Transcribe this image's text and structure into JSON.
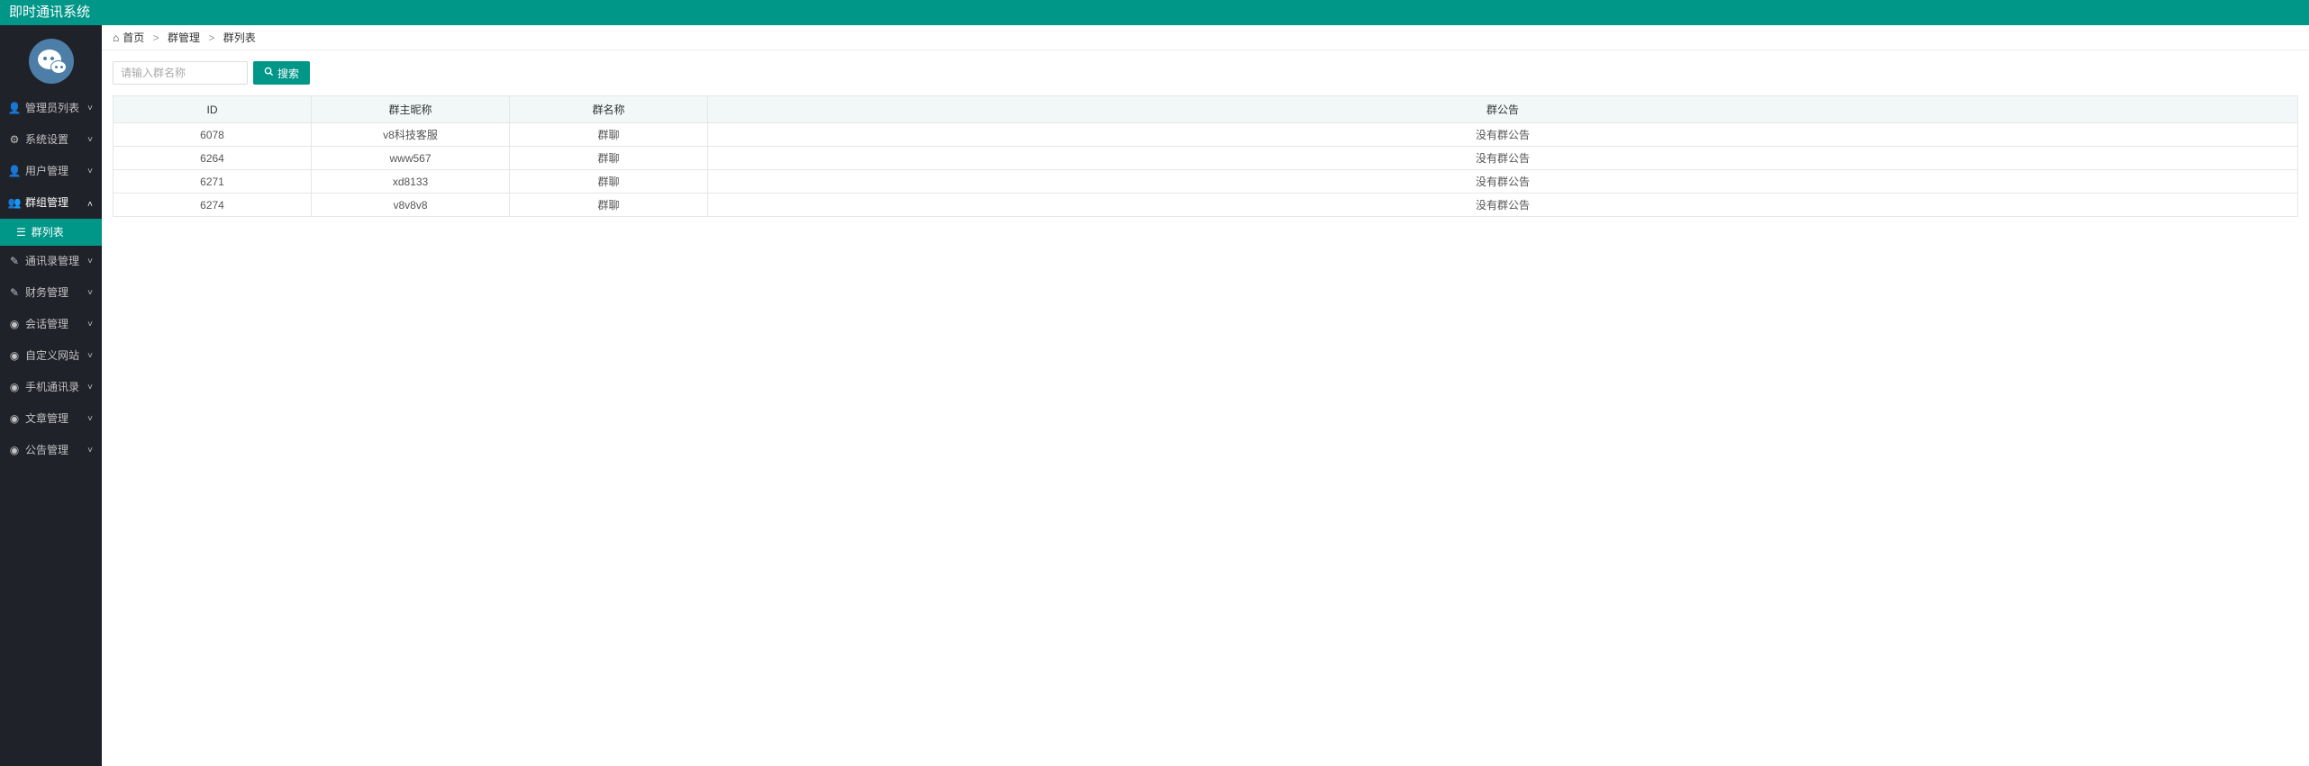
{
  "app_title": "即时通讯系统",
  "sidebar": {
    "items": [
      {
        "label": "管理员列表",
        "icon": "user"
      },
      {
        "label": "系统设置",
        "icon": "gear"
      },
      {
        "label": "用户管理",
        "icon": "user"
      },
      {
        "label": "群组管理",
        "icon": "users",
        "expanded": true,
        "sub": [
          {
            "label": "群列表",
            "icon": "list"
          }
        ]
      },
      {
        "label": "通讯录管理",
        "icon": "edit"
      },
      {
        "label": "财务管理",
        "icon": "edit"
      },
      {
        "label": "会话管理",
        "icon": "globe"
      },
      {
        "label": "自定义网站",
        "icon": "globe"
      },
      {
        "label": "手机通讯录",
        "icon": "globe"
      },
      {
        "label": "文章管理",
        "icon": "globe"
      },
      {
        "label": "公告管理",
        "icon": "globe"
      }
    ]
  },
  "breadcrumb": {
    "home": "首页",
    "crumb1": "群管理",
    "crumb2": "群列表"
  },
  "toolbar": {
    "search_placeholder": "请输入群名称",
    "search_btn": "搜索"
  },
  "table": {
    "headers": {
      "id": "ID",
      "owner": "群主昵称",
      "name": "群名称",
      "announce": "群公告"
    },
    "rows": [
      {
        "id": "6078",
        "owner": "v8科技客服",
        "name": "群聊",
        "announce": "没有群公告"
      },
      {
        "id": "6264",
        "owner": "www567",
        "name": "群聊",
        "announce": "没有群公告"
      },
      {
        "id": "6271",
        "owner": "xd8133",
        "name": "群聊",
        "announce": "没有群公告"
      },
      {
        "id": "6274",
        "owner": "v8v8v8",
        "name": "群聊",
        "announce": "没有群公告"
      }
    ]
  }
}
